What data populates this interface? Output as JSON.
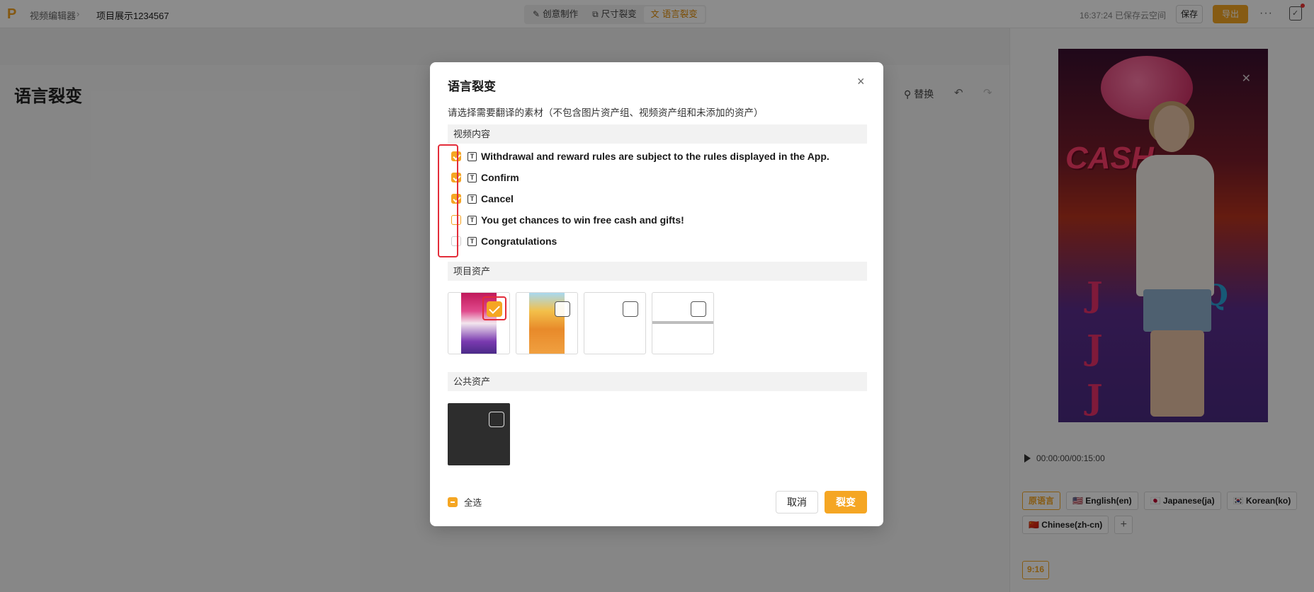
{
  "topbar": {
    "breadcrumb_root": "视频编辑器",
    "breadcrumb_sep": "›",
    "project_name": "项目展示1234567",
    "modes": [
      {
        "icon": "creative-icon",
        "label": "创意制作"
      },
      {
        "icon": "resize-icon",
        "label": "尺寸裂变"
      },
      {
        "icon": "translate-icon",
        "label": "语言裂变"
      }
    ],
    "active_mode": 2,
    "save_status": "16:37:24 已保存云空间",
    "save_label": "保存",
    "export_label": "导出",
    "more_label": "···"
  },
  "page": {
    "title": "语言裂变",
    "replace_label": "替换"
  },
  "preview": {
    "timecode": "00:00:00/00:15:00",
    "languages": [
      {
        "label": "原语言",
        "active": true
      },
      {
        "label": "🇺🇸 English(en)",
        "active": false
      },
      {
        "label": "🇯🇵 Japanese(ja)",
        "active": false
      },
      {
        "label": "🇰🇷 Korean(ko)",
        "active": false
      },
      {
        "label": "🇨🇳 Chinese(zh-cn)",
        "active": false
      }
    ],
    "add_language": "+",
    "ratio": "9:16",
    "video_text": {
      "cash": "CASH",
      "slot_j": "J",
      "slot_q": "Q"
    }
  },
  "dialog": {
    "title": "语言裂变",
    "close": "×",
    "description": "请选择需要翻译的素材（不包含图片资产组、视频资产组和未添加的资产）",
    "sections": {
      "video_content": "视频内容",
      "project_assets": "项目资产",
      "public_assets": "公共资产"
    },
    "text_items": [
      {
        "label": "Withdrawal and reward rules are subject to the rules displayed in the App.",
        "checked": true
      },
      {
        "label": "Confirm",
        "checked": true
      },
      {
        "label": "Cancel",
        "checked": true
      },
      {
        "label": "You get chances to win free cash and gifts!",
        "checked": false
      },
      {
        "label": "Congratulations",
        "checked": false
      }
    ],
    "text_type_icon": "T",
    "project_assets": [
      {
        "thumb": "game-promo-woman",
        "checked": true
      },
      {
        "thumb": "game-ui-screen",
        "checked": false
      },
      {
        "thumb": "blank",
        "checked": false
      },
      {
        "thumb": "blank-with-line",
        "checked": false
      }
    ],
    "public_assets": [
      {
        "thumb": "dark-square",
        "checked": false
      }
    ],
    "select_all_label": "全选",
    "cancel_label": "取消",
    "confirm_label": "裂变"
  },
  "colors": {
    "accent": "#f5a623",
    "highlight_outline": "#e32d3a"
  }
}
